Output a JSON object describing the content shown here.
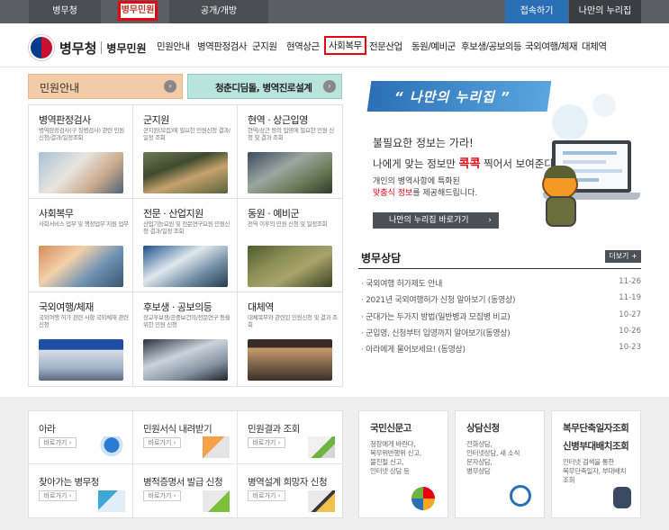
{
  "topbar": {
    "tabs": [
      "병무청",
      "병무민원",
      "공개/개방"
    ],
    "right": [
      "접속하기",
      "나만의 누리집"
    ]
  },
  "header": {
    "logo_name": "병무청",
    "logo_sub": "병무민원",
    "gnb": [
      "민원안내",
      "병역판정검사",
      "군지원",
      "현역상근",
      "사회복무",
      "전문산업",
      "동원/예비군",
      "후보생/공보의등",
      "국외여행/체재",
      "대체역"
    ]
  },
  "banners": {
    "left": "민원안내",
    "right": "청춘디딤돌, 병역진로설계",
    "arrow": "›"
  },
  "grid": [
    {
      "title": "병역판정검사",
      "desc": "병역판정검사(구 징병검사) 관련 민원신청/결과/일정조회"
    },
    {
      "title": "군지원",
      "desc": "군지원(모집)에 필요한 민원신청 결과/일정 조회"
    },
    {
      "title": "현역 · 상근입영",
      "desc": "현역/상근 등의 입영에 필요한 민원 신청 및 결과 조회"
    },
    {
      "title": "사회복무",
      "desc": "사회서비스 업무 및 행정업무 지원 업무"
    },
    {
      "title": "전문 · 산업지원",
      "desc": "산업기능요원 및 전문연구요원 민원신청 결과/일정 조회"
    },
    {
      "title": "동원 · 예비군",
      "desc": "전역 이후의 민원 신청 및 일정조회"
    },
    {
      "title": "국외여행/체재",
      "desc": "국외여행 허가 관련 사항 국외체재 관련 신청"
    },
    {
      "title": "후보생 · 공보의등",
      "desc": "장교후보생/공중보건의/전문연구 등을 위한 민원 신청"
    },
    {
      "title": "대체역",
      "desc": "대체복무와 관련된 민원신청 및 결과 조회"
    }
  ],
  "promo": {
    "ribbon": "“ 나만의 누리집 ”",
    "line1": "불필요한 정보는 가라!",
    "line2_pre": "나에게 맞는 정보만 ",
    "line2_em": "콕콕",
    "line2_post": " 찍어서 보여준다!",
    "line3": "개인의 병역사항에 특화된",
    "line4_em": "맞춤식 정보",
    "line4_post": "를 제공해드립니다.",
    "button": "나만의 누리집 바로가기",
    "button_arrow": "›"
  },
  "news": {
    "title": "병무상담",
    "more": "더보기 +",
    "items": [
      {
        "text": "· 국외여행 허가제도 안내",
        "date": "11-26"
      },
      {
        "text": "· 2021년 국외여행허가 신청 알아보기 (동영상)",
        "date": "11-19"
      },
      {
        "text": "· 군대가는 두가지 방법(일반병과 모집병 비교)",
        "date": "10-27"
      },
      {
        "text": "· 군입영, 신청부터 입영까지 알아보기(동영상)",
        "date": "10-26"
      },
      {
        "text": "· 아라에게 물어보세요! (동영상)",
        "date": "10-23"
      }
    ]
  },
  "quick": [
    {
      "title": "아라",
      "btn": "바로가기 ›"
    },
    {
      "title": "민원서식 내려받기",
      "btn": "바로가기 ›"
    },
    {
      "title": "민원결과 조회",
      "btn": "바로가기 ›"
    },
    {
      "title": "찾아가는 병무청",
      "btn": "바로가기 ›"
    },
    {
      "title": "병적증명서 발급 신청",
      "btn": "바로가기 ›"
    },
    {
      "title": "병역설계 희망자 신청",
      "btn": "바로가기 ›"
    }
  ],
  "side": [
    {
      "title": "국민신문고",
      "desc": [
        "청장에게 바란다,",
        "복무위반행위 신고,",
        "불친절 신고,",
        "인터넷 상담 등"
      ]
    },
    {
      "title": "상담신청",
      "desc": [
        "전화상담,",
        "인터넷상담, 새 소식",
        "문자상담,",
        "병무상담"
      ]
    },
    {
      "title": "복무단축일자조회",
      "title2": "신병부대배치조회",
      "desc": [
        "인터넷 검색을 통한",
        "복무단축일자, 부대배치",
        "조회"
      ]
    }
  ],
  "colors": {
    "accent_red": "#e60012",
    "topbar": "#5b5f63",
    "blue": "#2a6fb5"
  }
}
